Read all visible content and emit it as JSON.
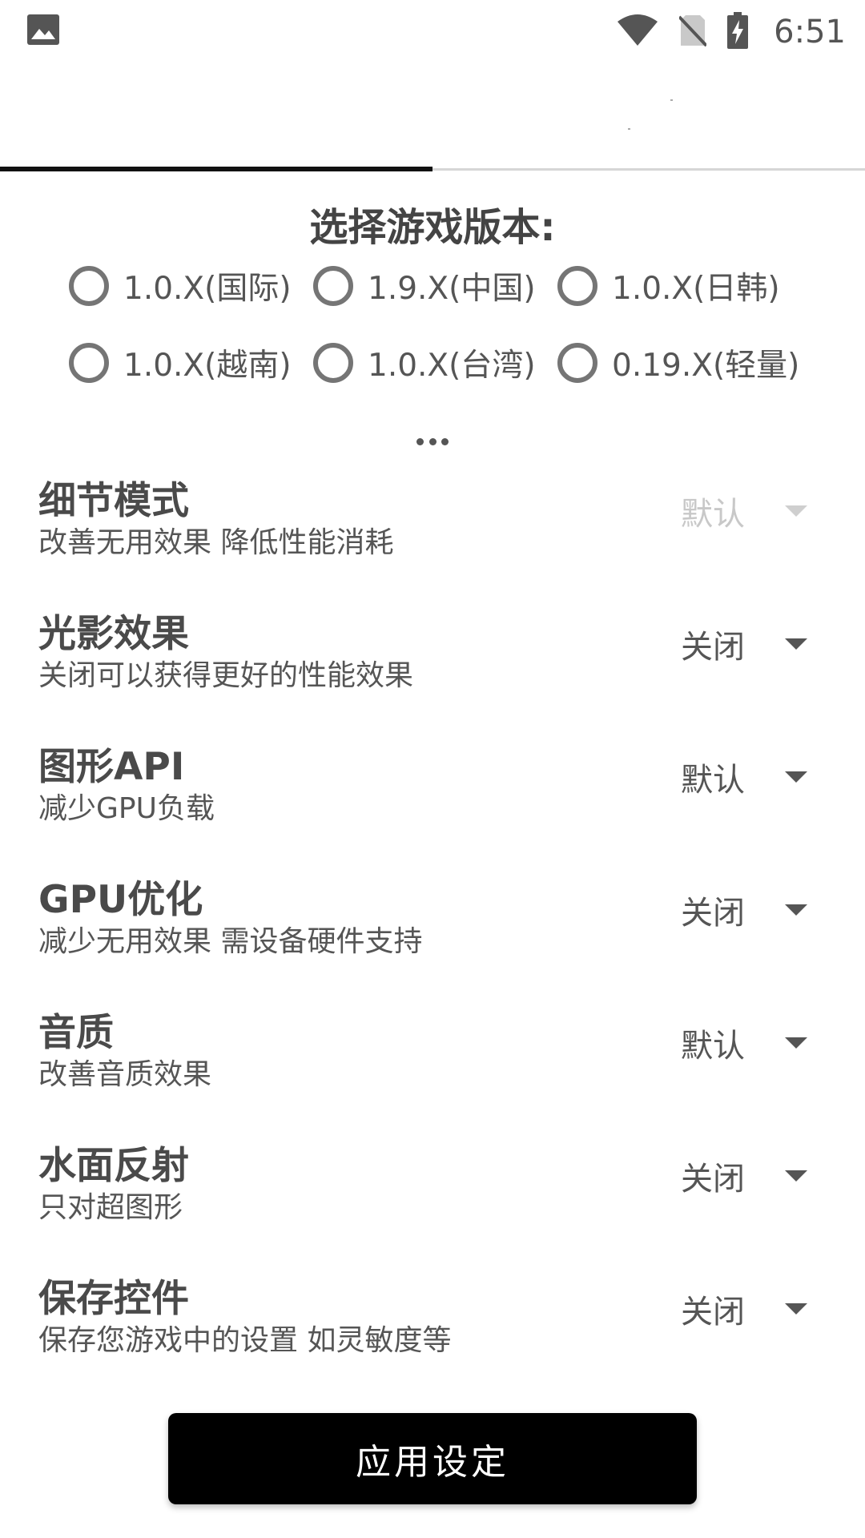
{
  "status_bar": {
    "time": "6:51",
    "icons": [
      "image-icon",
      "wifi-icon",
      "no-sim-icon",
      "battery-charging-icon"
    ]
  },
  "tabs": [
    {
      "label": "",
      "active": true
    },
    {
      "label": "",
      "active": false
    }
  ],
  "version": {
    "title": "选择游戏版本:",
    "options": [
      "1.0.X(国际)",
      "1.9.X(中国)",
      "1.0.X(日韩)",
      "1.0.X(越南)",
      "1.0.X(台湾)",
      "0.19.X(轻量)"
    ]
  },
  "settings": [
    {
      "title": "细节模式",
      "desc": "改善无用效果 降低性能消耗",
      "value": "默认",
      "disabled": true
    },
    {
      "title": "光影效果",
      "desc": "关闭可以获得更好的性能效果",
      "value": "关闭",
      "disabled": false
    },
    {
      "title": "图形API",
      "desc": "减少GPU负载",
      "value": "默认",
      "disabled": false
    },
    {
      "title": "GPU优化",
      "desc": "减少无用效果 需设备硬件支持",
      "value": "关闭",
      "disabled": false
    },
    {
      "title": "音质",
      "desc": "改善音质效果",
      "value": "默认",
      "disabled": false
    },
    {
      "title": "水面反射",
      "desc": "只对超图形",
      "value": "关闭",
      "disabled": false
    },
    {
      "title": "保存控件",
      "desc": "保存您游戏中的设置 如灵敏度等",
      "value": "关闭",
      "disabled": false
    }
  ],
  "apply_button": {
    "label": "应用设定"
  },
  "colors": {
    "background": "#ffffff",
    "text": "#4a4a4a",
    "button": "#000000",
    "disabled": "#c8c8c8"
  }
}
